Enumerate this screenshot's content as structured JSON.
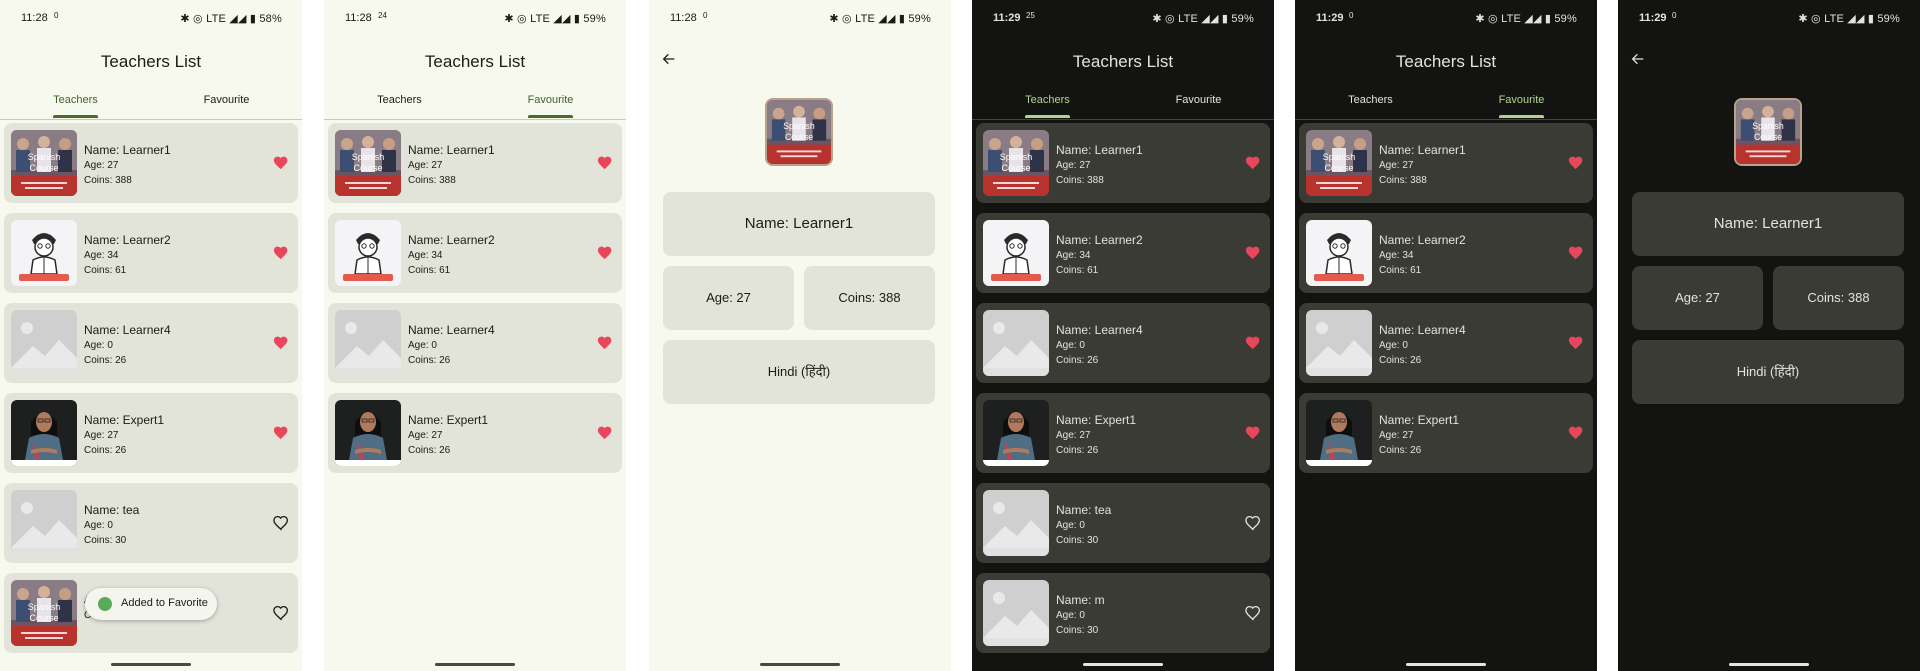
{
  "colors": {
    "heart": "#e8475b",
    "tab_active_light": "#44622a",
    "tab_active_dark": "#b2d38e"
  },
  "screens": [
    {
      "status": {
        "time": "11:28",
        "mini": "0",
        "right": "✱ ◎ LTE ◢◢ ▮ 58%"
      },
      "title": "Teachers List",
      "tabs": [
        "Teachers",
        "Favourite"
      ],
      "active_tab": 0,
      "cards": [
        {
          "name": "Name: Learner1",
          "age": "Age: 27",
          "coins": "Coins: 388",
          "thumb": "course",
          "fav": true
        },
        {
          "name": "Name: Learner2",
          "age": "Age: 34",
          "coins": "Coins: 61",
          "thumb": "cartoon",
          "fav": true
        },
        {
          "name": "Name: Learner4",
          "age": "Age: 0",
          "coins": "Coins: 26",
          "thumb": "placeholder",
          "fav": true
        },
        {
          "name": "Name: Expert1",
          "age": "Age: 27",
          "coins": "Coins: 26",
          "thumb": "woman",
          "fav": true
        },
        {
          "name": "Name: tea",
          "age": "Age: 0",
          "coins": "Coins: 30",
          "thumb": "placeholder",
          "fav": false
        },
        {
          "name": "",
          "age": "Age: 27",
          "coins": "Coins: 388",
          "thumb": "course",
          "fav": false
        }
      ],
      "toast": "Added to Favorite"
    },
    {
      "status": {
        "time": "11:28",
        "mini": "24",
        "right": "✱ ◎ LTE ◢◢ ▮ 59%"
      },
      "title": "Teachers List",
      "tabs": [
        "Teachers",
        "Favourite"
      ],
      "active_tab": 1,
      "cards": [
        {
          "name": "Name: Learner1",
          "age": "Age: 27",
          "coins": "Coins: 388",
          "thumb": "course",
          "fav": true
        },
        {
          "name": "Name: Learner2",
          "age": "Age: 34",
          "coins": "Coins: 61",
          "thumb": "cartoon",
          "fav": true
        },
        {
          "name": "Name: Learner4",
          "age": "Age: 0",
          "coins": "Coins: 26",
          "thumb": "placeholder",
          "fav": true
        },
        {
          "name": "Name: Expert1",
          "age": "Age: 27",
          "coins": "Coins: 26",
          "thumb": "woman",
          "fav": true
        }
      ]
    },
    {
      "status": {
        "time": "11:28",
        "mini": "0",
        "right": "✱ ◎ LTE ◢◢ ▮ 59%"
      },
      "detail": {
        "name": "Name: Learner1",
        "age": "Age: 27",
        "coins": "Coins: 388",
        "language": "Hindi (हिंदी)"
      }
    },
    {
      "status": {
        "time": "11:29",
        "mini": "25",
        "right": "✱ ◎ LTE ◢◢ ▮ 59%"
      },
      "title": "Teachers List",
      "tabs": [
        "Teachers",
        "Favourite"
      ],
      "active_tab": 0,
      "cards": [
        {
          "name": "Name: Learner1",
          "age": "Age: 27",
          "coins": "Coins: 388",
          "thumb": "course",
          "fav": true
        },
        {
          "name": "Name: Learner2",
          "age": "Age: 34",
          "coins": "Coins: 61",
          "thumb": "cartoon",
          "fav": true
        },
        {
          "name": "Name: Learner4",
          "age": "Age: 0",
          "coins": "Coins: 26",
          "thumb": "placeholder",
          "fav": true
        },
        {
          "name": "Name: Expert1",
          "age": "Age: 27",
          "coins": "Coins: 26",
          "thumb": "woman",
          "fav": true
        },
        {
          "name": "Name: tea",
          "age": "Age: 0",
          "coins": "Coins: 30",
          "thumb": "placeholder",
          "fav": false
        },
        {
          "name": "Name: m",
          "age": "Age: 0",
          "coins": "Coins: 30",
          "thumb": "placeholder",
          "fav": false
        }
      ]
    },
    {
      "status": {
        "time": "11:29",
        "mini": "0",
        "right": "✱ ◎ LTE ◢◢ ▮ 59%"
      },
      "title": "Teachers List",
      "tabs": [
        "Teachers",
        "Favourite"
      ],
      "active_tab": 1,
      "cards": [
        {
          "name": "Name: Learner1",
          "age": "Age: 27",
          "coins": "Coins: 388",
          "thumb": "course",
          "fav": true
        },
        {
          "name": "Name: Learner2",
          "age": "Age: 34",
          "coins": "Coins: 61",
          "thumb": "cartoon",
          "fav": true
        },
        {
          "name": "Name: Learner4",
          "age": "Age: 0",
          "coins": "Coins: 26",
          "thumb": "placeholder",
          "fav": true
        },
        {
          "name": "Name: Expert1",
          "age": "Age: 27",
          "coins": "Coins: 26",
          "thumb": "woman",
          "fav": true
        }
      ]
    },
    {
      "status": {
        "time": "11:29",
        "mini": "0",
        "right": "✱ ◎ LTE ◢◢ ▮ 59%"
      },
      "detail": {
        "name": "Name: Learner1",
        "age": "Age: 27",
        "coins": "Coins: 388",
        "language": "Hindi (हिंदी)"
      }
    }
  ],
  "thumb_text": {
    "course_line1": "Spanish",
    "course_line2": "Course"
  }
}
